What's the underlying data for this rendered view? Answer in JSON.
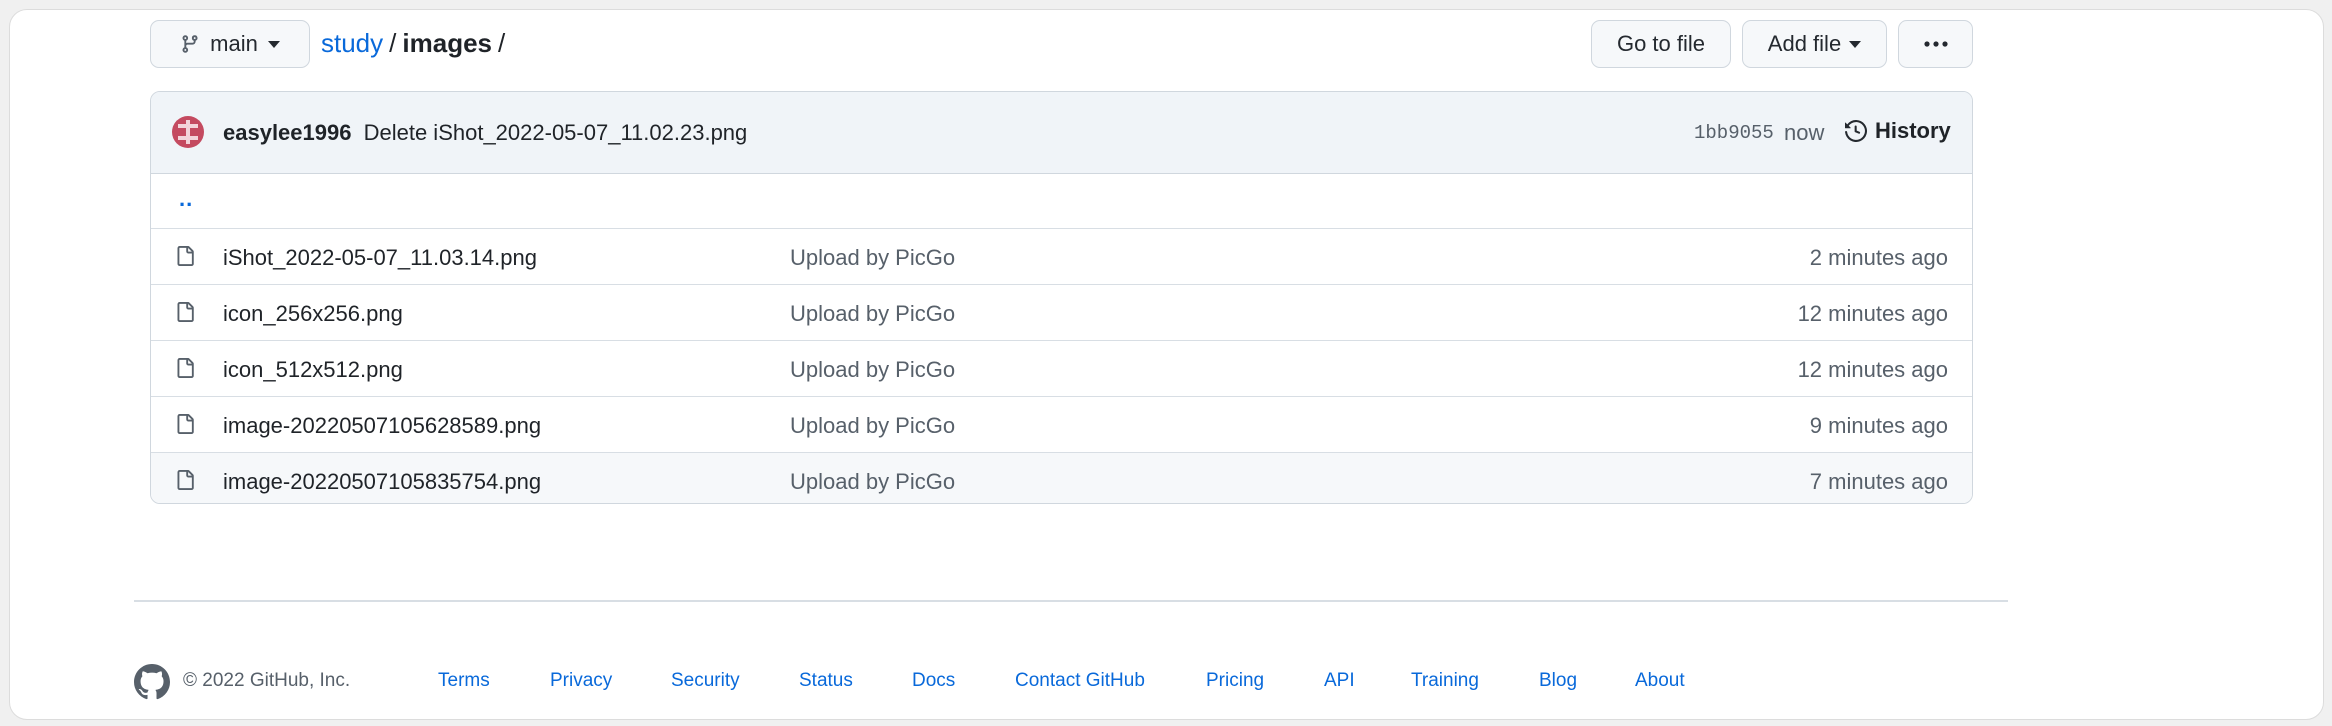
{
  "branch": {
    "name": "main"
  },
  "breadcrumb": {
    "repo": "study",
    "sep1": "/",
    "folder": "images",
    "sep2": "/"
  },
  "actions": {
    "goto_label": "Go to file",
    "add_label": "Add file",
    "more_label": "···"
  },
  "commit": {
    "author": "easylee1996",
    "message": "Delete iShot_2022-05-07_11.02.23.png",
    "sha": "1bb9055",
    "time": "now",
    "history_label": "History"
  },
  "parent_link": "..",
  "files": [
    {
      "name": "iShot_2022-05-07_11.03.14.png",
      "message": "Upload by PicGo",
      "age": "2 minutes ago"
    },
    {
      "name": "icon_256x256.png",
      "message": "Upload by PicGo",
      "age": "12 minutes ago"
    },
    {
      "name": "icon_512x512.png",
      "message": "Upload by PicGo",
      "age": "12 minutes ago"
    },
    {
      "name": "image-20220507105628589.png",
      "message": "Upload by PicGo",
      "age": "9 minutes ago"
    },
    {
      "name": "image-20220507105835754.png",
      "message": "Upload by PicGo",
      "age": "7 minutes ago"
    }
  ],
  "footer": {
    "copyright": "© 2022 GitHub, Inc.",
    "links": [
      "Terms",
      "Privacy",
      "Security",
      "Status",
      "Docs",
      "Contact GitHub",
      "Pricing",
      "API",
      "Training",
      "Blog",
      "About"
    ]
  },
  "colors": {
    "link": "#0969da",
    "muted": "#57606a",
    "border": "#d0d7de",
    "header_bg": "#f0f4f8",
    "avatar": "#c44a60"
  },
  "icons": [
    "git-branch-icon",
    "caret-down-icon",
    "kebab-horizontal-icon",
    "history-icon",
    "file-icon",
    "github-mark-icon"
  ]
}
